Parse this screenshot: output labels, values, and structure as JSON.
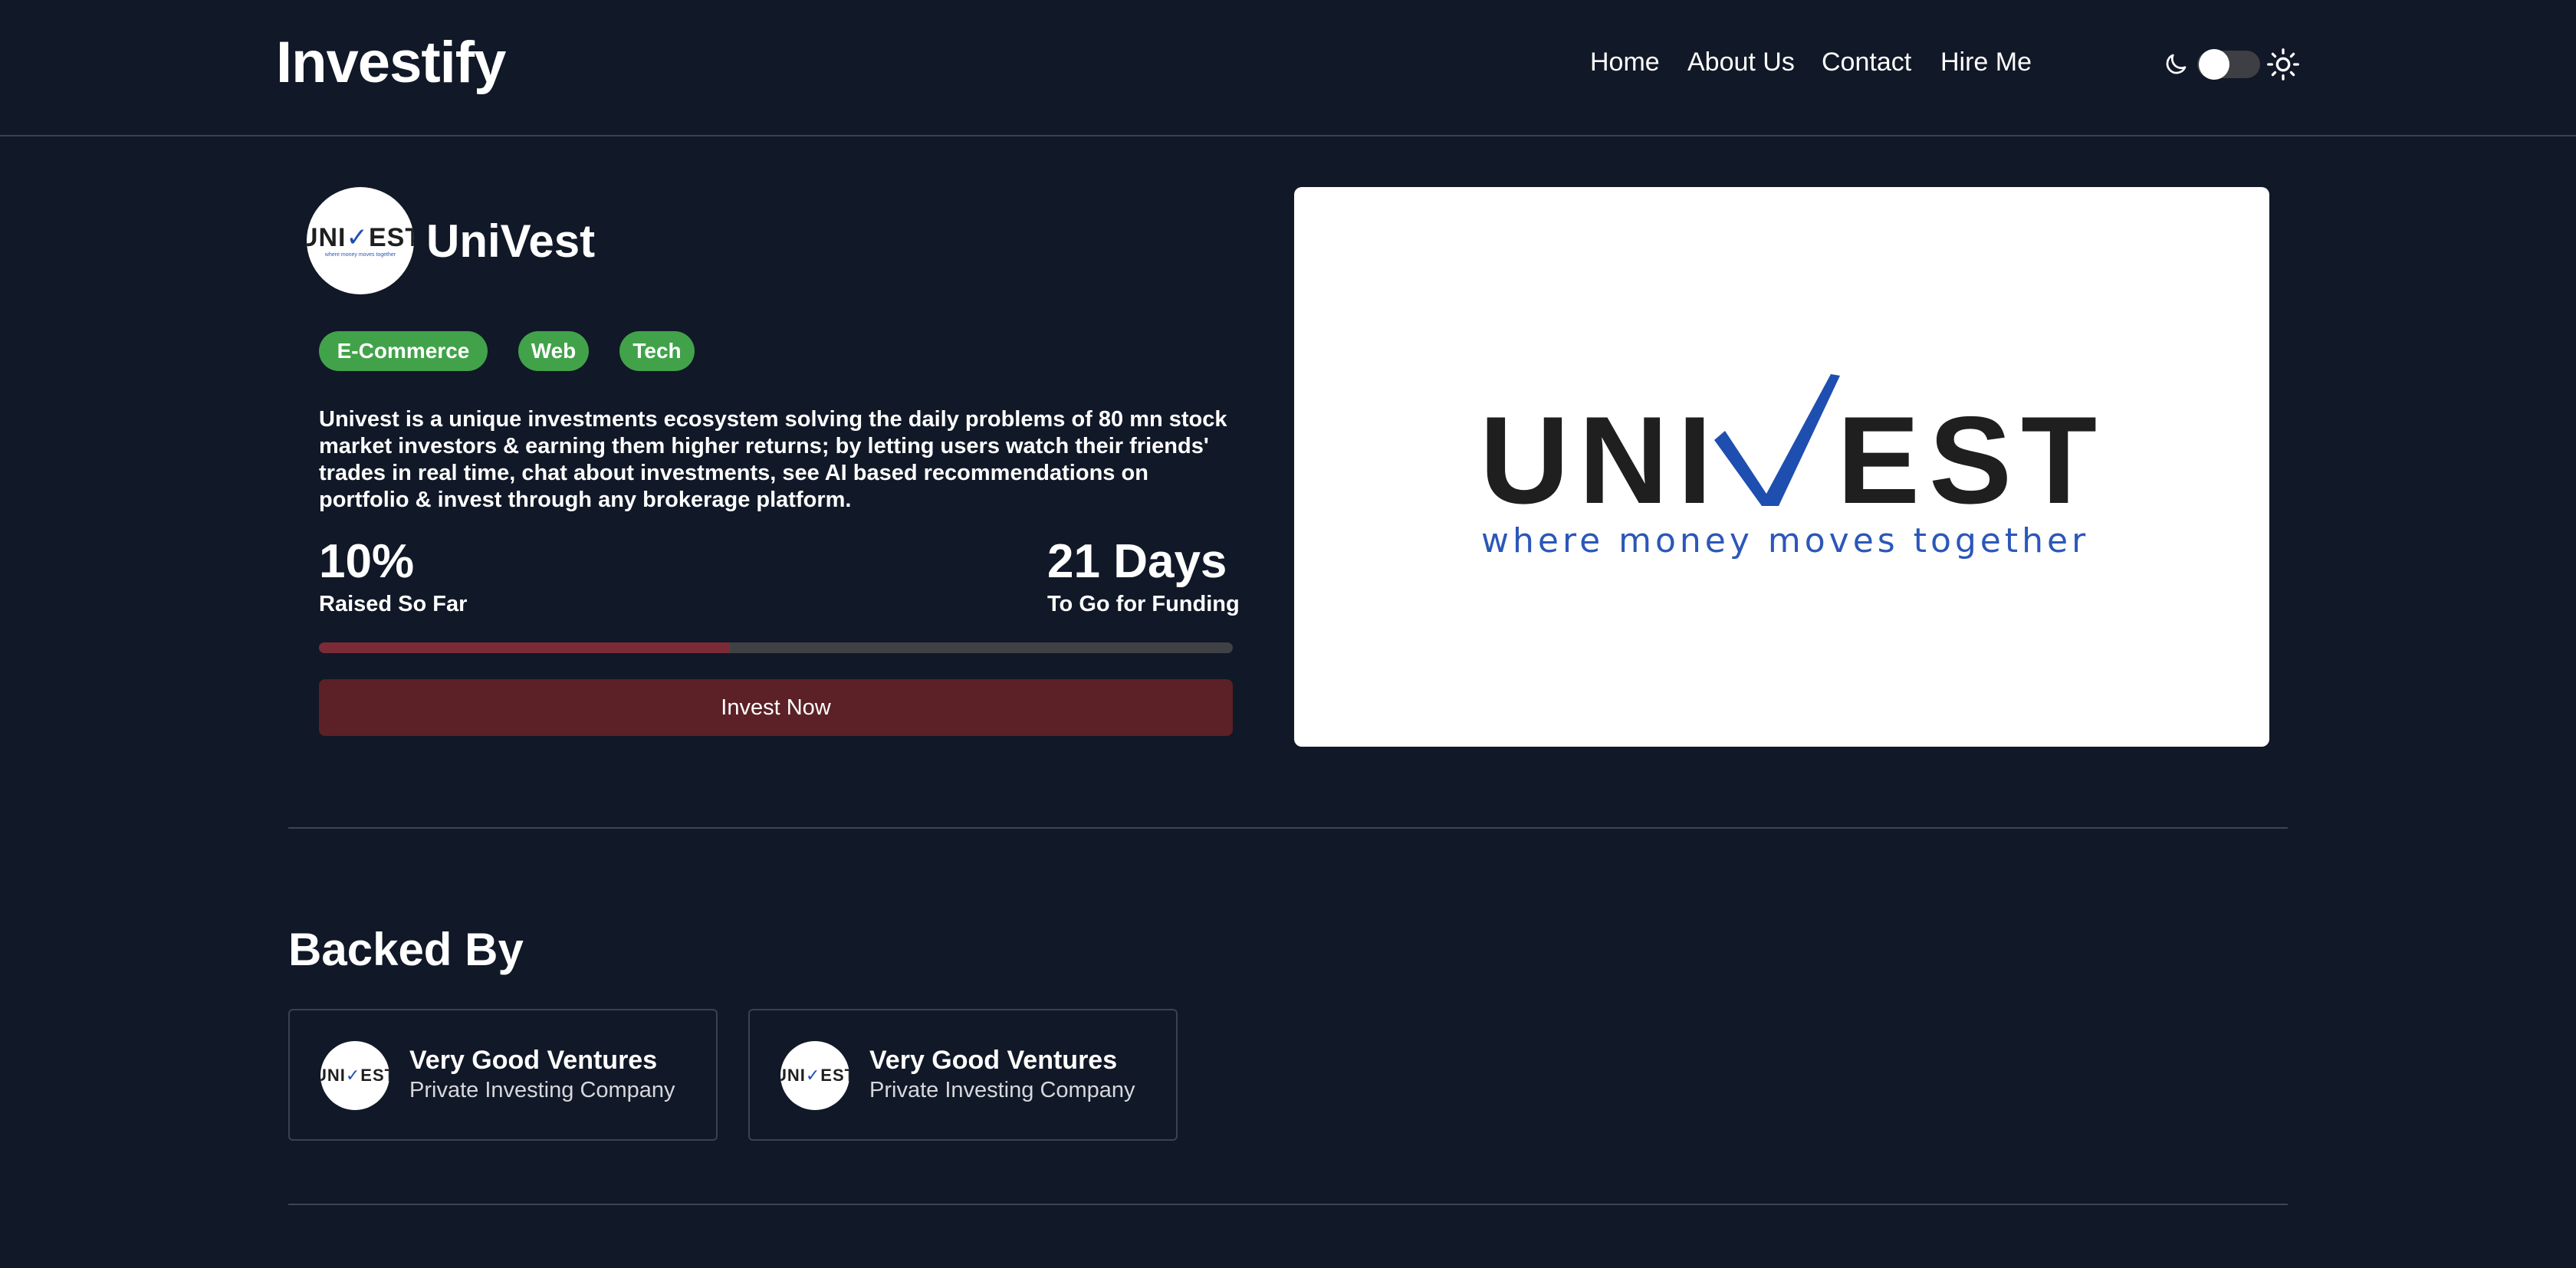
{
  "brand": "Investify",
  "nav": {
    "items": [
      {
        "label": "Home"
      },
      {
        "label": "About Us"
      },
      {
        "label": "Contact"
      },
      {
        "label": "Hire Me"
      }
    ]
  },
  "theme_toggle": {
    "icons": [
      "moon-icon",
      "sun-icon"
    ],
    "state": "dark"
  },
  "company": {
    "name": "UniVest",
    "tags": [
      "E-Commerce",
      "Web",
      "Tech"
    ],
    "description": "Univest is a unique investments ecosystem solving the daily problems of 80 mn stock market investors & earning them higher returns; by letting users watch their friends' trades in real time, chat about investments, see AI based recommendations on portfolio & invest through any brokerage platform.",
    "raised": {
      "value": "10%",
      "label": "Raised So Far"
    },
    "days_left": {
      "value": "21 Days",
      "label": "To Go for Funding"
    },
    "progress_fraction": 0.45,
    "invest_button": "Invest Now"
  },
  "logo": {
    "wordmark_left": "UNI",
    "wordmark_right": "EST",
    "tagline": "where money moves together",
    "colors": {
      "text": "#1f1f1f",
      "accent": "#1e4fb0"
    }
  },
  "backed_by": {
    "title": "Backed By",
    "backers": [
      {
        "name": "Very Good Ventures",
        "type": "Private Investing Company"
      },
      {
        "name": "Very Good Ventures",
        "type": "Private Investing Company"
      }
    ]
  },
  "colors": {
    "background": "#111827",
    "tag": "#41a24a",
    "progress_fill": "#7d2a38",
    "button": "#5b2127"
  }
}
